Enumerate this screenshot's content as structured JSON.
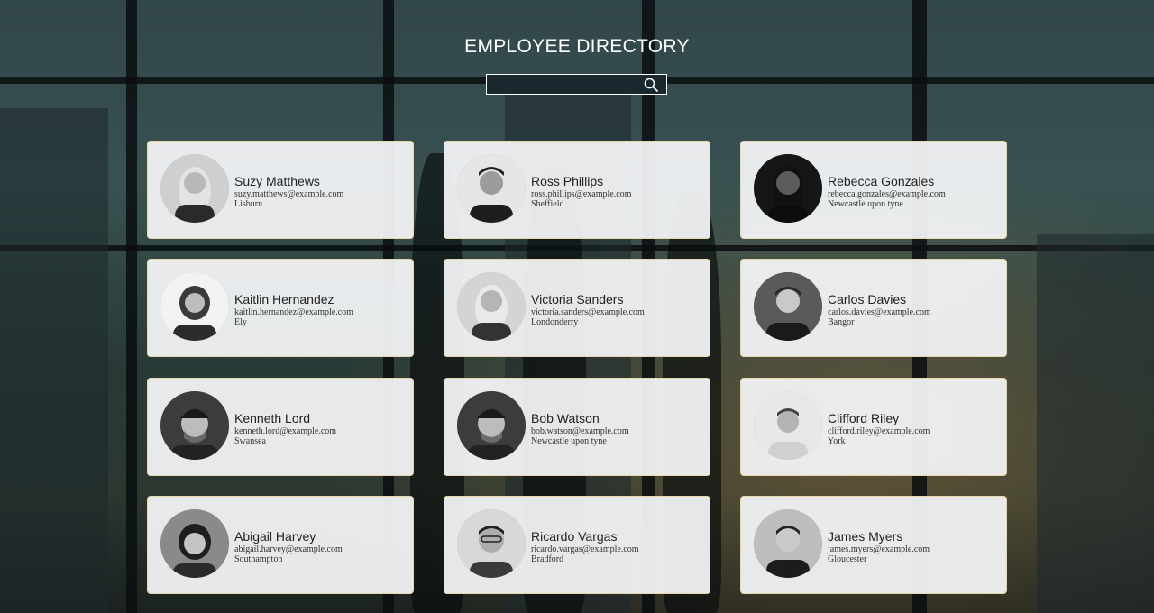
{
  "header": {
    "title": "EMPLOYEE DIRECTORY"
  },
  "search": {
    "value": "",
    "placeholder": "",
    "icon": "search-icon"
  },
  "employees": [
    {
      "name": "Suzy Matthews",
      "email": "suzy.matthews@example.com",
      "city": "Lisburn"
    },
    {
      "name": "Ross Phillips",
      "email": "ross.phillips@example.com",
      "city": "Sheffield"
    },
    {
      "name": "Rebecca Gonzales",
      "email": "rebecca.gonzales@example.com",
      "city": "Newcastle upon tyne"
    },
    {
      "name": "Kaitlin Hernandez",
      "email": "kaitlin.hernandez@example.com",
      "city": "Ely"
    },
    {
      "name": "Victoria Sanders",
      "email": "victoria.sanders@example.com",
      "city": "Londonderry"
    },
    {
      "name": "Carlos Davies",
      "email": "carlos.davies@example.com",
      "city": "Bangor"
    },
    {
      "name": "Kenneth Lord",
      "email": "kenneth.lord@example.com",
      "city": "Swansea"
    },
    {
      "name": "Bob Watson",
      "email": "bob.watson@example.com",
      "city": "Newcastle upon tyne"
    },
    {
      "name": "Clifford Riley",
      "email": "clifford.riley@example.com",
      "city": "York"
    },
    {
      "name": "Abigail Harvey",
      "email": "abigail.harvey@example.com",
      "city": "Southampton"
    },
    {
      "name": "Ricardo Vargas",
      "email": "ricardo.vargas@example.com",
      "city": "Bradford"
    },
    {
      "name": "James Myers",
      "email": "james.myers@example.com",
      "city": "Gloucester"
    }
  ],
  "colors": {
    "card_border": "#e8d9a8",
    "card_bg": "#f3f4f6",
    "title": "#ffffff"
  }
}
